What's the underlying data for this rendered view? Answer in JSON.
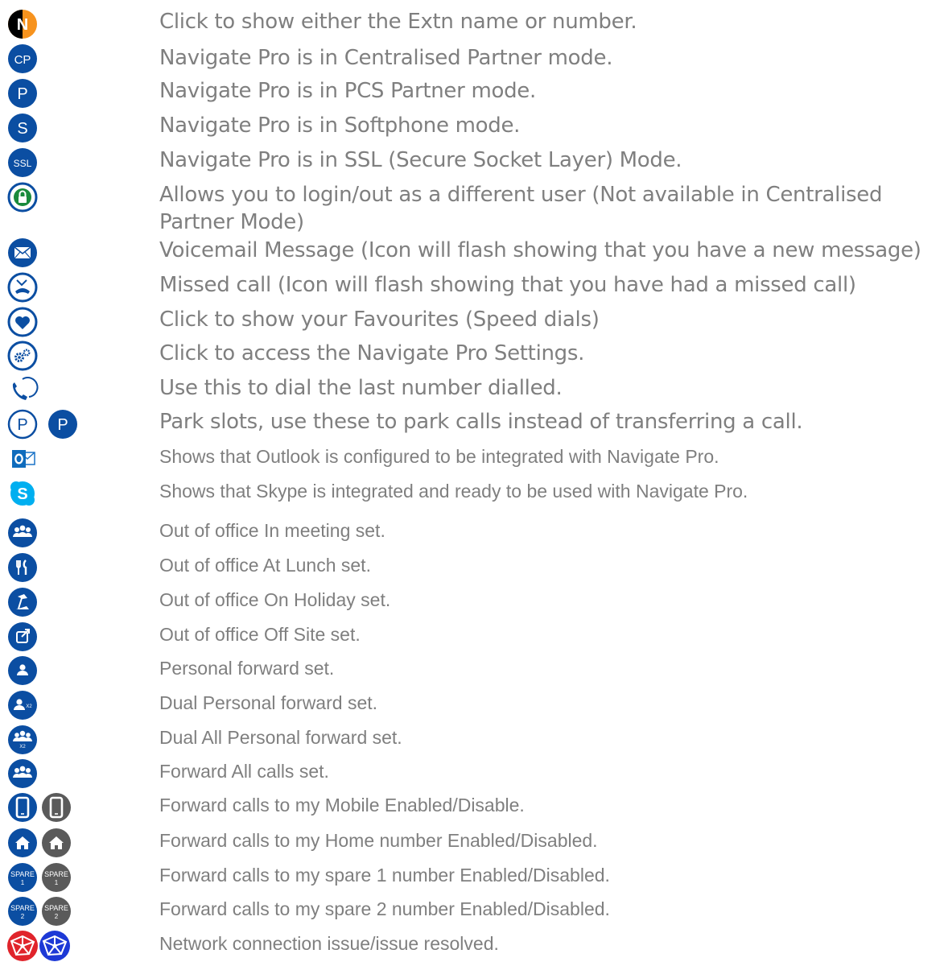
{
  "colors": {
    "navy": "#0b4ea2",
    "grey": "#5a5a5a",
    "text": "#7f7f7f",
    "orange": "#f7931e",
    "red": "#e0242b"
  },
  "rows": [
    {
      "icons": [
        "name-number-toggle-icon"
      ],
      "text": "Click to show either the Extn name or number."
    },
    {
      "icons": [
        "centralised-partner-icon"
      ],
      "label": "CP",
      "text": "Navigate Pro is in Centralised Partner mode."
    },
    {
      "icons": [
        "pcs-partner-icon"
      ],
      "label": "P",
      "text": "Navigate Pro is in PCS Partner mode."
    },
    {
      "icons": [
        "softphone-icon"
      ],
      "label": "S",
      "text": "Navigate Pro is in Softphone mode."
    },
    {
      "icons": [
        "ssl-icon"
      ],
      "label": "SSL",
      "text": "Navigate Pro is in SSL (Secure Socket Layer) Mode."
    },
    {
      "icons": [
        "lock-login-icon"
      ],
      "text": "Allows you to login/out as a different user (Not available in Centralised Partner Mode)"
    },
    {
      "icons": [
        "voicemail-icon"
      ],
      "text": "Voicemail Message (Icon will flash showing that you have a new message)"
    },
    {
      "icons": [
        "missed-call-icon"
      ],
      "text": "Missed call (Icon will flash showing that you have had a missed call)"
    },
    {
      "icons": [
        "favourites-heart-icon"
      ],
      "text": "Click to show your Favourites (Speed dials)"
    },
    {
      "icons": [
        "settings-gears-icon"
      ],
      "text": "Click to access the Navigate Pro Settings."
    },
    {
      "icons": [
        "redial-icon"
      ],
      "text": "Use this to dial the last number dialled."
    },
    {
      "icons": [
        "park-slot-empty-icon",
        "park-slot-filled-icon"
      ],
      "label": "P",
      "text": "Park slots, use these to park calls instead of transferring a call."
    },
    {
      "icons": [
        "outlook-icon"
      ],
      "text": "Shows that Outlook is configured to be integrated with Navigate Pro."
    },
    {
      "icons": [
        "skype-icon"
      ],
      "text": "Shows that Skype is integrated and ready to be used with Navigate Pro."
    },
    {
      "icons": [
        "in-meeting-icon"
      ],
      "text": "Out of office In meeting set."
    },
    {
      "icons": [
        "at-lunch-icon"
      ],
      "text": "Out of office At Lunch set."
    },
    {
      "icons": [
        "on-holiday-icon"
      ],
      "text": "Out of office On Holiday set."
    },
    {
      "icons": [
        "off-site-icon"
      ],
      "text": "Out of office Off Site set."
    },
    {
      "icons": [
        "personal-forward-icon"
      ],
      "text": "Personal forward set."
    },
    {
      "icons": [
        "dual-personal-forward-icon"
      ],
      "label": "X2",
      "text": "Dual Personal forward set."
    },
    {
      "icons": [
        "dual-all-personal-forward-icon"
      ],
      "label": "X2",
      "text": "Dual All Personal forward set."
    },
    {
      "icons": [
        "forward-all-icon"
      ],
      "text": "Forward All calls set."
    },
    {
      "icons": [
        "mobile-enabled-icon",
        "mobile-disabled-icon"
      ],
      "text": "Forward calls to my Mobile Enabled/Disable."
    },
    {
      "icons": [
        "home-enabled-icon",
        "home-disabled-icon"
      ],
      "text": "Forward calls to my Home number Enabled/Disabled."
    },
    {
      "icons": [
        "spare1-enabled-icon",
        "spare1-disabled-icon"
      ],
      "label": "SPARE",
      "sublabel": "1",
      "text": "Forward calls to my spare 1 number Enabled/Disabled."
    },
    {
      "icons": [
        "spare2-enabled-icon",
        "spare2-disabled-icon"
      ],
      "label": "SPARE",
      "sublabel": "2",
      "text": "Forward calls to my spare 2 number Enabled/Disabled."
    },
    {
      "icons": [
        "network-issue-icon",
        "network-resolved-icon"
      ],
      "text": "Network connection issue/issue resolved."
    }
  ]
}
